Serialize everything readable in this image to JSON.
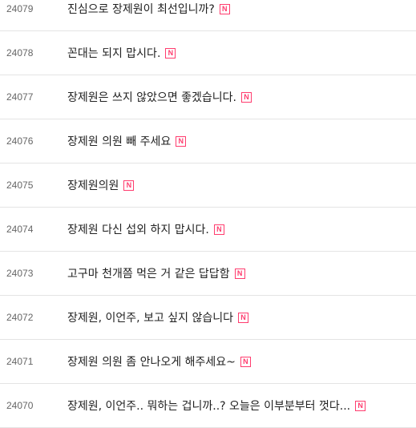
{
  "posts": [
    {
      "number": "24079",
      "title": "진심으로 장제원이 최선입니까?",
      "badge": "N"
    },
    {
      "number": "24078",
      "title": "꼰대는 되지 맙시다.",
      "badge": "N"
    },
    {
      "number": "24077",
      "title": "장제원은 쓰지 않았으면 좋겠습니다.",
      "badge": "N"
    },
    {
      "number": "24076",
      "title": "장제원 의원 빼 주세요",
      "badge": "N"
    },
    {
      "number": "24075",
      "title": "장제원의원",
      "badge": "N"
    },
    {
      "number": "24074",
      "title": "장제원 다신 섭외 하지 맙시다.",
      "badge": "N"
    },
    {
      "number": "24073",
      "title": "고구마 천개쯤 먹은 거 같은 답답함",
      "badge": "N"
    },
    {
      "number": "24072",
      "title": "장제원, 이언주, 보고 싶지 않습니다",
      "badge": "N"
    },
    {
      "number": "24071",
      "title": "장제원 의원 좀 안나오게 해주세요~",
      "badge": "N"
    },
    {
      "number": "24070",
      "title": "장제원, 이언주.. 뭐하는 겁니까..? 오늘은 이부분부터 껏다...",
      "badge": "N"
    }
  ],
  "colors": {
    "badge": "#ff3c6e",
    "divider": "#e4e4e4",
    "number_text": "#666666",
    "title_text": "#222222"
  },
  "icons": {
    "new_badge": "new-badge-icon"
  }
}
